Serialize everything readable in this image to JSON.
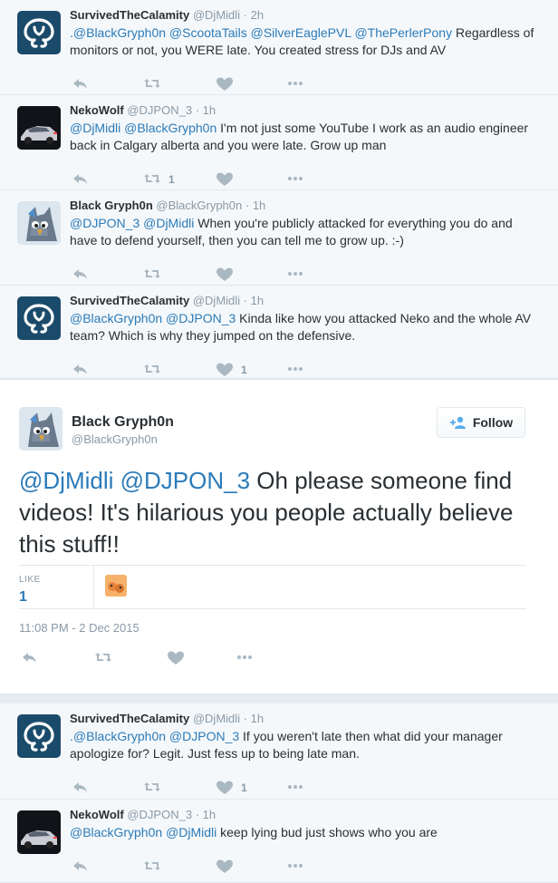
{
  "tweets_before": [
    {
      "name": "SurvivedTheCalamity",
      "handle": "@DjMidli",
      "time": "· 2h",
      "avatar": "logo",
      "segments": [
        {
          "t": ".@BlackGryph0n @ScootaTails @SilverEaglePVL @ThePerlerPony",
          "m": true
        },
        {
          "t": " Regardless of monitors or not, you WERE late. You created stress for DJs and AV",
          "m": false
        }
      ],
      "retweets": "",
      "likes": ""
    },
    {
      "name": "NekoWolf",
      "handle": "@DJPON_3",
      "time": "· 1h",
      "avatar": "car",
      "segments": [
        {
          "t": "@DjMidli @BlackGryph0n",
          "m": true
        },
        {
          "t": " I'm not just some YouTube I work as an audio engineer back in Calgary alberta and you were late. Grow up man",
          "m": false
        }
      ],
      "retweets": "1",
      "likes": ""
    },
    {
      "name": "Black Gryph0n",
      "handle": "@BlackGryph0n",
      "time": "· 1h",
      "avatar": "gryph",
      "segments": [
        {
          "t": "@DJPON_3 @DjMidli",
          "m": true
        },
        {
          "t": " When you're publicly attacked for everything you do and have to defend yourself, then you can tell me to grow up. :-)",
          "m": false
        }
      ],
      "retweets": "",
      "likes": ""
    },
    {
      "name": "SurvivedTheCalamity",
      "handle": "@DjMidli",
      "time": "· 1h",
      "avatar": "logo",
      "segments": [
        {
          "t": "@BlackGryph0n @DJPON_3",
          "m": true
        },
        {
          "t": " Kinda like how you attacked Neko and the whole AV team? Which is why they jumped on the defensive.",
          "m": false
        }
      ],
      "retweets": "",
      "likes": "1"
    }
  ],
  "main_tweet": {
    "name": "Black Gryph0n",
    "handle": "@BlackGryph0n",
    "follow_label": "Follow",
    "segments": [
      {
        "t": "@DjMidli @DJPON_3",
        "m": true
      },
      {
        "t": " Oh please someone find videos! It's hilarious you people actually believe this stuff!!",
        "m": false
      }
    ],
    "like_label": "LIKE",
    "like_count": "1",
    "date": "11:08 PM - 2 Dec 2015"
  },
  "tweets_after": [
    {
      "name": "SurvivedTheCalamity",
      "handle": "@DjMidli",
      "time": "· 1h",
      "avatar": "logo",
      "segments": [
        {
          "t": ".@BlackGryph0n @DJPON_3",
          "m": true
        },
        {
          "t": " If you weren't late then what did your manager apologize for? Legit. Just fess up to being late man.",
          "m": false
        }
      ],
      "retweets": "",
      "likes": "1"
    },
    {
      "name": "NekoWolf",
      "handle": "@DJPON_3",
      "time": "· 1h",
      "avatar": "car",
      "segments": [
        {
          "t": "@BlackGryph0n @DjMidli",
          "m": true
        },
        {
          "t": " keep lying bud just shows who you are",
          "m": false
        }
      ],
      "retweets": "",
      "likes": ""
    }
  ],
  "icons": {
    "reply": "reply-icon",
    "retweet": "retweet-icon",
    "like": "heart-icon",
    "more": "more-icon",
    "follow": "follow-person-icon"
  },
  "colors": {
    "link": "#2b7bb9",
    "muted": "#8899a6",
    "icon": "#aab8c2",
    "bg": "#f5f8fa",
    "border": "#e1e8ed"
  }
}
